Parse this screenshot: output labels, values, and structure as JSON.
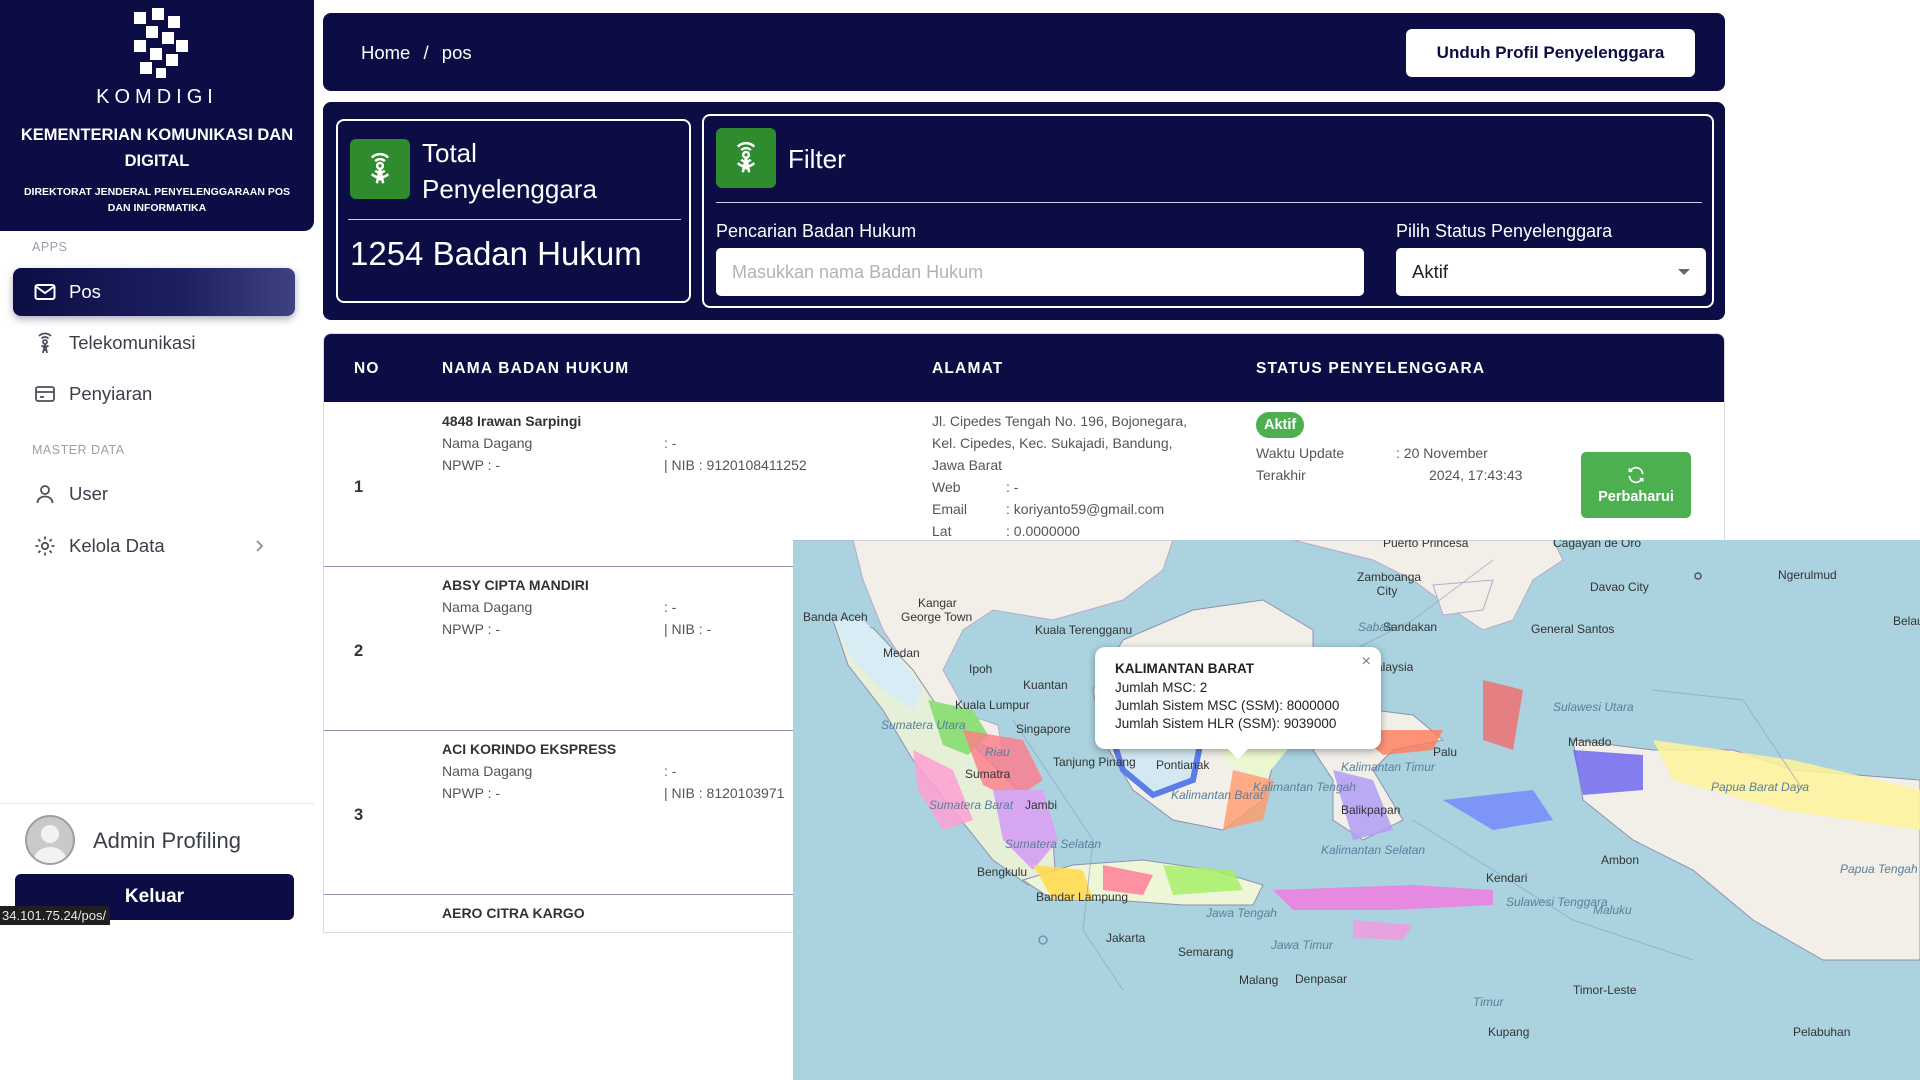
{
  "brand": {
    "logo_word": "KOMDIGI",
    "name": "KEMENTERIAN KOMUNIKASI DAN DIGITAL",
    "subtitle": "DIREKTORAT JENDERAL PENYELENGGARAAN POS DAN INFORMATIKA",
    "color": "#0b0d44"
  },
  "sidebar": {
    "apps_heading": "APPS",
    "master_heading": "MASTER DATA",
    "items": [
      {
        "label": "Pos",
        "icon": "mail-icon",
        "active": true
      },
      {
        "label": "Telekomunikasi",
        "icon": "broadcast-icon"
      },
      {
        "label": "Penyiaran",
        "icon": "card-icon"
      },
      {
        "label": "User",
        "icon": "user-icon"
      },
      {
        "label": "Kelola Data",
        "icon": "gear-icon",
        "has_submenu": true
      }
    ],
    "profile_name": "Admin Profiling",
    "logout_label": "Keluar",
    "status_url": "34.101.75.24/pos/"
  },
  "topbar": {
    "breadcrumb": [
      "Home",
      "/",
      "pos"
    ],
    "download_label": "Unduh Profil Penyelenggara"
  },
  "total_card": {
    "title": "Total Penyelenggara",
    "value": "1254 Badan Hukum",
    "icon": "antenna-icon"
  },
  "filter": {
    "title": "Filter",
    "search_label": "Pencarian Badan Hukum",
    "search_placeholder": "Masukkan nama Badan Hukum",
    "status_label": "Pilih Status Penyelenggara",
    "status_value": "Aktif"
  },
  "table": {
    "headers": [
      "NO",
      "NAMA BADAN HUKUM",
      "ALAMAT",
      "STATUS PENYELENGGARA"
    ],
    "rows": [
      {
        "no": "1",
        "name": "4848 Irawan Sarpingi",
        "trade_label": "Nama Dagang",
        "trade_value": ":  -",
        "npwp": "NPWP : -",
        "nib": "|  NIB : 9120108411252",
        "address": [
          "Jl. Cipedes Tengah No. 196, Bojonegara,",
          "Kel. Cipedes, Kec. Sukajadi, Bandung,",
          "Jawa Barat"
        ],
        "web_label": "Web",
        "web_value": ":  -",
        "email_label": "Email",
        "email_value": ":  koriyanto59@gmail.com",
        "lat_label": "Lat",
        "lat_value": ":  0.0000000",
        "status": "Aktif",
        "update_label": "Waktu Update",
        "update_label2": "Terakhir",
        "update_value": ":    20 November",
        "update_value2": "2024, 17:43:43",
        "refresh_label": "Perbaharui"
      },
      {
        "no": "2",
        "name": "ABSY CIPTA MANDIRI",
        "trade_label": "Nama Dagang",
        "trade_value": ":  -",
        "npwp": "NPWP : -",
        "nib": "|  NIB : -"
      },
      {
        "no": "3",
        "name": "ACI KORINDO EKSPRESS",
        "trade_label": "Nama Dagang",
        "trade_value": ":  -",
        "npwp": "NPWP : -",
        "nib": "|  NIB : 8120103971"
      },
      {
        "name": "AERO CITRA KARGO"
      }
    ]
  },
  "map": {
    "popup": {
      "title": "KALIMANTAN BARAT",
      "lines": [
        "Jumlah MSC: 2",
        "Jumlah Sistem MSC (SSM): 8000000",
        "Jumlah Sistem HLR (SSM): 9039000"
      ],
      "close": "×"
    },
    "labels": [
      "Banda Aceh",
      "Medan",
      "George Town",
      "Kangar",
      "Ipoh",
      "Kuala Terengganu",
      "Kuantan",
      "Kuala Lumpur",
      "Singapore",
      "Riau",
      "Sumatra",
      "Tanjung Pinang",
      "Pontianak",
      "Jambi",
      "Sumatera Selatan",
      "Bengkulu",
      "Bandar Lampung",
      "Jakarta",
      "Semarang",
      "Malang",
      "Denpasar",
      "Jawa Tengah",
      "Jawa Timur",
      "Kalimantan Tengah",
      "Kalimantan Barat",
      "Kalimantan Timur",
      "Kalimantan Selatan",
      "Balikpapan",
      "Palu",
      "Kendari",
      "Sulawesi Tenggara",
      "Manado",
      "Ambon",
      "Maluku",
      "Papua Barat Daya",
      "Papua Tengah",
      "Timor-Leste",
      "Kupang",
      "Timur",
      "Zamboanga City",
      "Davao City",
      "General Santos",
      "Sandakan",
      "Sabah",
      "Malaysia",
      "Ngerulmud",
      "Belau",
      "Sumatera Utara",
      "Sulawesi Utara",
      "Sumatera Barat",
      "Puerto Princesa",
      "Cagayan de Oro",
      "Pelabuhan"
    ]
  }
}
